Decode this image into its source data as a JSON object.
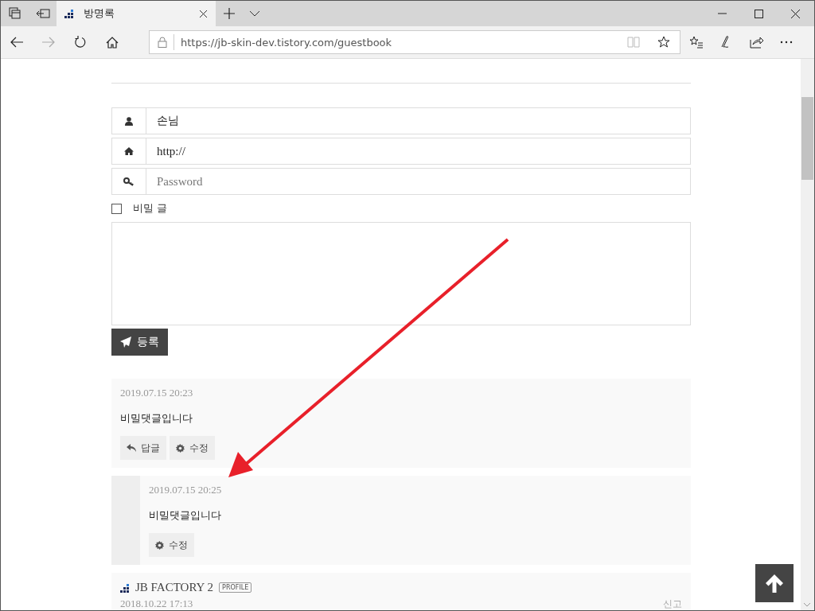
{
  "browser": {
    "tab": {
      "title": "방명록",
      "selected": true
    },
    "address": "https://jb-skin-dev.tistory.com/guestbook"
  },
  "form": {
    "name": {
      "value": "손님"
    },
    "homepage": {
      "value": "http://"
    },
    "password": {
      "placeholder": "Password"
    },
    "secret": {
      "label": "비밀 글",
      "checked": false
    },
    "submit": "등록"
  },
  "comments": [
    {
      "kind": "comment",
      "date": "2019.07.15 20:23",
      "text": "비밀댓글입니다",
      "actions": [
        {
          "kind": "reply",
          "label": "답글"
        },
        {
          "kind": "edit",
          "label": "수정"
        }
      ]
    },
    {
      "kind": "reply",
      "date": "2019.07.15 20:25",
      "text": "비밀댓글입니다",
      "actions": [
        {
          "kind": "edit",
          "label": "수정"
        }
      ]
    },
    {
      "kind": "comment",
      "author": "JB FACTORY 2",
      "badge": "PROFILE",
      "date": "2018.10.22 17:13",
      "report": "신고"
    }
  ]
}
